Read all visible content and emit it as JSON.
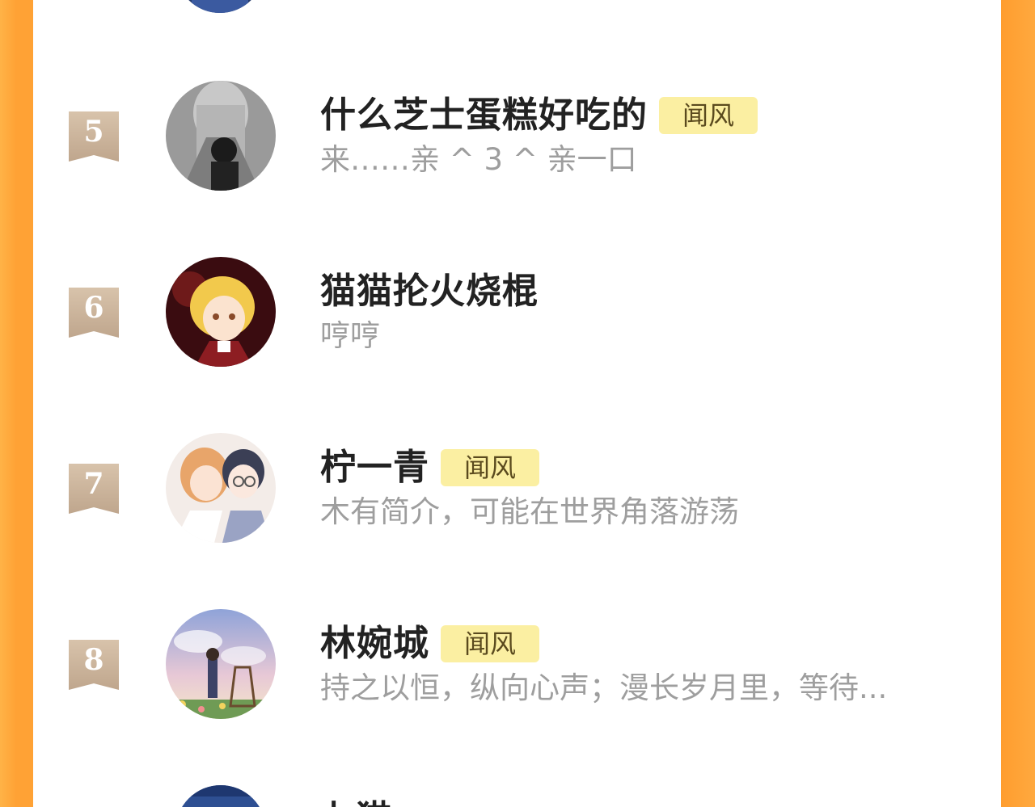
{
  "list": {
    "top_partial": {
      "avatar_icon": "avatar-partial-top-icon"
    },
    "items": [
      {
        "rank": "5",
        "name": "什么芝士蛋糕好吃的",
        "tag": "闻风",
        "bio": "来……亲 ^ 3 ^ 亲一口",
        "avatar_icon": "avatar-statue-icon",
        "accent": "#8c8c8c"
      },
      {
        "rank": "6",
        "name": "猫猫抡火烧棍",
        "tag": "",
        "bio": "哼哼",
        "avatar_icon": "avatar-blonde-character-icon",
        "accent": "#7b1f1f"
      },
      {
        "rank": "7",
        "name": "柠一青",
        "tag": "闻风",
        "bio": "木有简介，可能在世界角落游荡",
        "avatar_icon": "avatar-pair-characters-icon",
        "accent": "#e9dcd8"
      },
      {
        "rank": "8",
        "name": "林婉城",
        "tag": "闻风",
        "bio": "持之以恒，纵向心声；漫长岁月里，等待...",
        "avatar_icon": "avatar-painter-landscape-icon",
        "accent": "#a7b4d9"
      }
    ],
    "bottom_partial": {
      "name_fragment": "七猫",
      "avatar_icon": "avatar-partial-bottom-icon"
    }
  },
  "colors": {
    "page_edge": "#ffa235",
    "rank_badge": "#c9b29b",
    "tag_bg": "#fbefa2",
    "name": "#222222",
    "bio": "#9e9e9e"
  }
}
